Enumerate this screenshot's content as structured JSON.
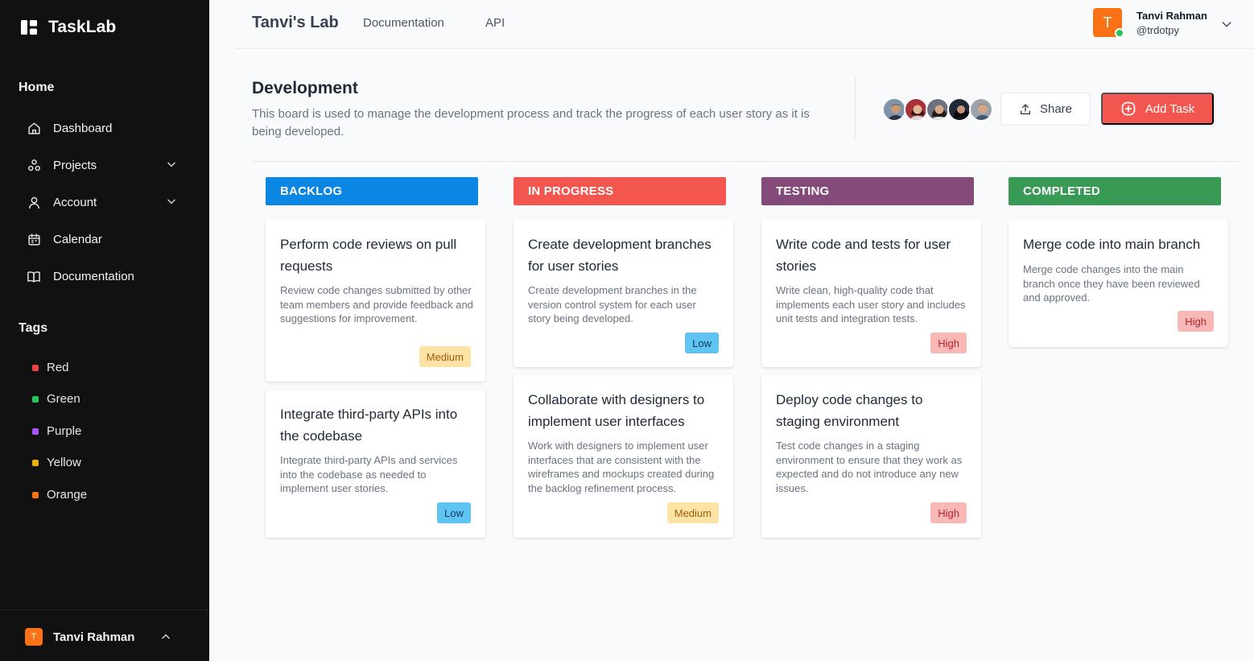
{
  "app": {
    "name": "TaskLab"
  },
  "sidebar": {
    "home_heading": "Home",
    "nav": [
      {
        "label": "Dashboard",
        "icon": "home-icon"
      },
      {
        "label": "Projects",
        "icon": "projects-icon"
      },
      {
        "label": "Account",
        "icon": "user-icon"
      },
      {
        "label": "Calendar",
        "icon": "calendar-icon"
      },
      {
        "label": "Documentation",
        "icon": "book-icon"
      }
    ],
    "tags_heading": "Tags",
    "tags": [
      {
        "label": "Red",
        "color": "#ef4444"
      },
      {
        "label": "Green",
        "color": "#22c55e"
      },
      {
        "label": "Purple",
        "color": "#a855f7"
      },
      {
        "label": "Yellow",
        "color": "#eab308"
      },
      {
        "label": "Orange",
        "color": "#f97316"
      }
    ],
    "user": {
      "initial": "T",
      "name": "Tanvi Rahman"
    }
  },
  "topbar": {
    "title": "Tanvi's Lab",
    "links": [
      "Documentation",
      "API"
    ],
    "user": {
      "initial": "T",
      "name": "Tanvi Rahman",
      "handle": "@trdotpy",
      "status_color": "#22c55e"
    }
  },
  "board": {
    "title": "Development",
    "description": "This board is used to manage the development process and track the progress of each user story as it is being developed.",
    "share_label": "Share",
    "add_task_label": "Add Task",
    "member_count": 5
  },
  "columns": [
    {
      "title": "BACKLOG",
      "color": "#0b86e3",
      "cards": [
        {
          "title": "Perform code reviews on pull requests",
          "description": "Review code changes submitted by other team members and provide feedback and suggestions for improvement.",
          "priority": "Medium"
        },
        {
          "title": "Integrate third-party APIs into the codebase",
          "description": "Integrate third-party APIs and services into the codebase as needed to implement user stories.",
          "priority": "Low"
        }
      ]
    },
    {
      "title": "IN PROGRESS",
      "color": "#f2564f",
      "cards": [
        {
          "title": "Create development branches for user stories",
          "description": "Create development branches in the version control system for each user story being developed.",
          "priority": "Low"
        },
        {
          "title": "Collaborate with designers to implement user interfaces",
          "description": "Work with designers to implement user interfaces that are consistent with the wireframes and mockups created during the backlog refinement process.",
          "priority": "Medium"
        }
      ]
    },
    {
      "title": "TESTING",
      "color": "#834a7a",
      "cards": [
        {
          "title": "Write code and tests for user stories",
          "description": "Write clean, high-quality code that implements each user story and includes unit tests and integration tests.",
          "priority": "High"
        },
        {
          "title": "Deploy code changes to staging environment",
          "description": "Test code changes in a staging environment to ensure that they work as expected and do not introduce any new issues.",
          "priority": "High"
        }
      ]
    },
    {
      "title": "COMPLETED",
      "color": "#389a55",
      "cards": [
        {
          "title": "Merge code into main branch",
          "description": "Merge code changes into the main branch once they have been reviewed and approved.",
          "priority": "High"
        }
      ]
    }
  ]
}
